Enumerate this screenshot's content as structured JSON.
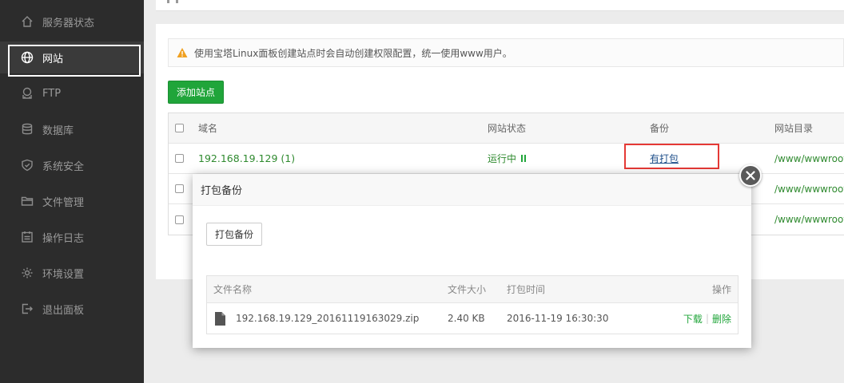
{
  "sidebar": {
    "items": [
      {
        "label": "服务器状态",
        "icon": "home-icon"
      },
      {
        "label": "网站",
        "icon": "globe-icon"
      },
      {
        "label": "FTP",
        "icon": "ftp-icon"
      },
      {
        "label": "数据库",
        "icon": "database-icon"
      },
      {
        "label": "系统安全",
        "icon": "shield-icon"
      },
      {
        "label": "文件管理",
        "icon": "folder-icon"
      },
      {
        "label": "操作日志",
        "icon": "log-icon"
      },
      {
        "label": "环境设置",
        "icon": "gear-icon"
      },
      {
        "label": "退出面板",
        "icon": "logout-icon"
      }
    ],
    "active": "网站"
  },
  "notice": {
    "text": "使用宝塔Linux面板创建站点时会自动创建权限配置，统一使用www用户。",
    "icon": "warning-icon",
    "icon_color": "#f0a020"
  },
  "toolbar": {
    "add_site_label": "添加站点"
  },
  "site_table": {
    "headers": {
      "domain": "域名",
      "status": "网站状态",
      "backup": "备份",
      "dir": "网站目录"
    },
    "rows": [
      {
        "domain": "192.168.19.129 (1)",
        "status": "运行中",
        "backup": "有打包",
        "dir": "/www/wwwroot"
      },
      {
        "dir": "/www/wwwroot"
      },
      {
        "dir": "/www/wwwroot"
      }
    ]
  },
  "modal": {
    "title": "打包备份",
    "pack_button": "打包备份",
    "table": {
      "headers": {
        "name": "文件名称",
        "size": "文件大小",
        "time": "打包时间",
        "action": "操作"
      },
      "rows": [
        {
          "name": "192.168.19.129_20161119163029.zip",
          "size": "2.40 KB",
          "time": "2016-11-19 16:30:30",
          "download": "下载",
          "separator": "|",
          "delete": "删除"
        }
      ]
    }
  },
  "colors": {
    "accent": "#20a53a",
    "sidebar_bg": "#2c2c2c",
    "highlight": "#e53935"
  }
}
